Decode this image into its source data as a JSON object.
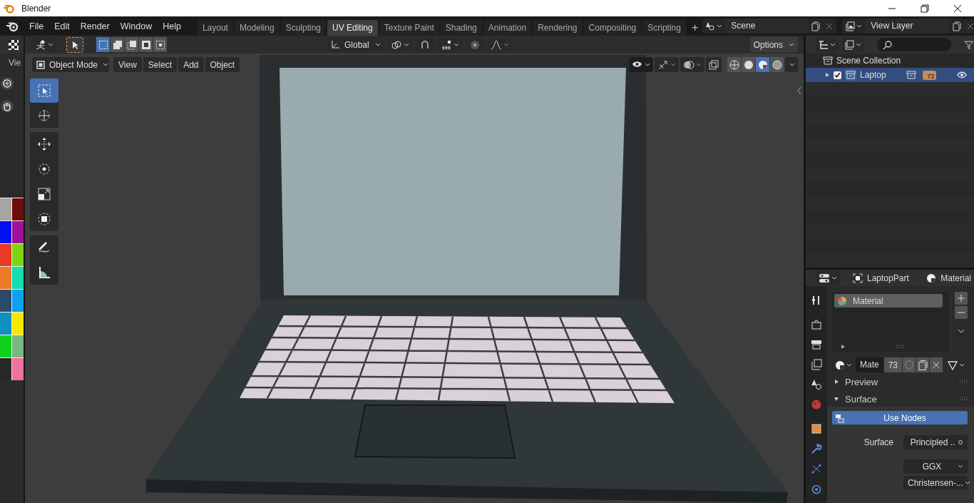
{
  "window": {
    "title": "Blender"
  },
  "menu": [
    "File",
    "Edit",
    "Render",
    "Window",
    "Help"
  ],
  "workspaces": [
    {
      "label": "Layout",
      "selected": false
    },
    {
      "label": "Modeling",
      "selected": false
    },
    {
      "label": "Sculpting",
      "selected": false
    },
    {
      "label": "UV Editing",
      "selected": true
    },
    {
      "label": "Texture Paint",
      "selected": false
    },
    {
      "label": "Shading",
      "selected": false
    },
    {
      "label": "Animation",
      "selected": false
    },
    {
      "label": "Rendering",
      "selected": false
    },
    {
      "label": "Compositing",
      "selected": false
    },
    {
      "label": "Scripting",
      "selected": false
    }
  ],
  "add_workspace": "+",
  "scene": {
    "name": "Scene"
  },
  "view_layer": {
    "name": "View Layer"
  },
  "side_editor": {
    "label": "Vie",
    "palette": [
      {
        "color": "#a8a4a4"
      },
      {
        "color": "#6e0c0c"
      },
      {
        "color": "#0010f0"
      },
      {
        "color": "#a0109a"
      },
      {
        "color": "#e83a24"
      },
      {
        "color": "#7ed414"
      },
      {
        "color": "#ee7a28"
      },
      {
        "color": "#10e0b0"
      },
      {
        "color": "#2c4a68"
      },
      {
        "color": "#10a0f0"
      },
      {
        "color": "#1090c0"
      },
      {
        "color": "#f8e800"
      },
      {
        "color": "#10d020"
      },
      {
        "color": "#78b880"
      },
      {
        "color": "#282828"
      },
      {
        "color": "#f070a0"
      }
    ]
  },
  "viewport": {
    "orientation": "Global",
    "options": "Options",
    "mode": "Object Mode",
    "menus": [
      "View",
      "Select",
      "Add",
      "Object"
    ],
    "tool_groups": [
      [
        {
          "kind": "select",
          "selected": true
        },
        {
          "kind": "cursor",
          "selected": false
        }
      ],
      [
        {
          "kind": "move",
          "selected": false
        },
        {
          "kind": "rotate",
          "selected": false
        },
        {
          "kind": "scale",
          "selected": false
        },
        {
          "kind": "transform",
          "selected": false
        }
      ],
      [
        {
          "kind": "annotate",
          "selected": false
        },
        {
          "kind": "measure",
          "selected": false
        }
      ]
    ]
  },
  "outliner": {
    "root": "Scene Collection",
    "items": [
      {
        "label": "Laptop",
        "selected": true,
        "checked": true,
        "badge": "73"
      }
    ]
  },
  "properties": {
    "object": "LaptopPart",
    "context": "Material",
    "slots": [
      {
        "label": "Material",
        "selected": true
      }
    ],
    "material_name": "Mate",
    "users": "73",
    "panels": [
      {
        "label": "Preview",
        "expanded": false
      },
      {
        "label": "Surface",
        "expanded": true
      }
    ],
    "use_nodes": "Use Nodes",
    "surface_label": "Surface",
    "surface_value": "Principled ..",
    "distribution": "GGX",
    "subsurface": "Christensen-..."
  }
}
